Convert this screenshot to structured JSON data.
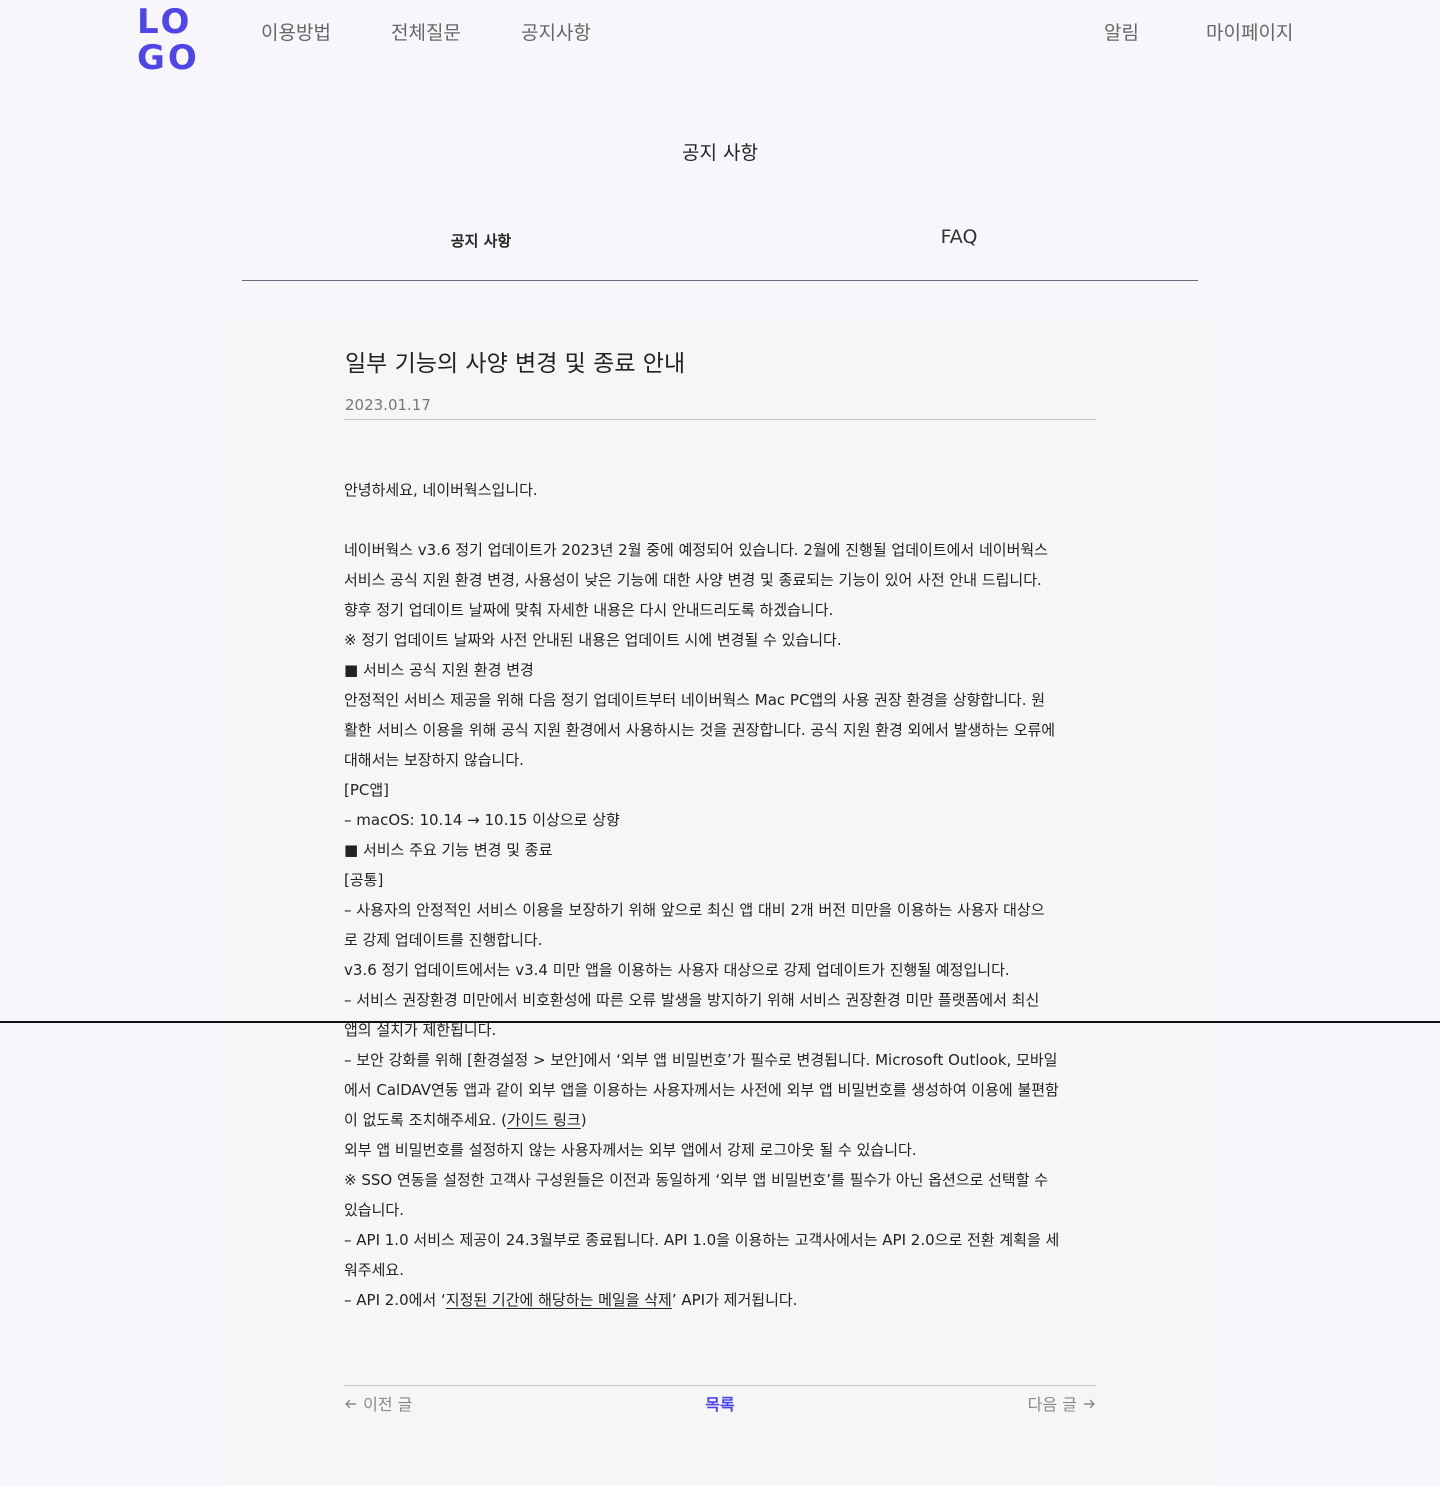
{
  "header": {
    "logo_line1": "LO",
    "logo_line2": "GO",
    "nav_left": [
      "이용방법",
      "전체질문",
      "공지사항"
    ],
    "nav_right": [
      "알림",
      "마이페이지"
    ],
    "accent_color": "#4f46e5"
  },
  "page": {
    "title": "공지 사항",
    "tabs": [
      "공지 사항",
      "FAQ"
    ]
  },
  "post": {
    "title": "일부 기능의 사양 변경 및 종료 안내",
    "date": "2023.01.17",
    "lines": [
      "안녕하세요, 네이버웍스입니다.",
      "",
      "네이버웍스 v3.6 정기 업데이트가 2023년 2월 중에 예정되어 있습니다. 2월에 진행될 업데이트에서 네이버웍스",
      "서비스 공식 지원 환경 변경, 사용성이 낮은 기능에 대한 사양 변경 및 종료되는 기능이 있어 사전 안내 드립니다.",
      "향후 정기 업데이트 날짜에 맞춰 자세한 내용은 다시 안내드리도록 하겠습니다.",
      "※ 정기 업데이트 날짜와 사전 안내된 내용은 업데이트 시에 변경될 수 있습니다.",
      "■ 서비스 공식 지원 환경 변경",
      "안정적인 서비스 제공을 위해 다음 정기 업데이트부터 네이버웍스 Mac PC앱의 사용 권장 환경을 상향합니다. 원",
      "활한 서비스 이용을 위해 공식 지원 환경에서 사용하시는 것을 권장합니다. 공식 지원 환경 외에서 발생하는 오류에",
      "대해서는 보장하지 않습니다.",
      "[PC앱]",
      "– macOS: 10.14 → 10.15 이상으로 상향",
      "■ 서비스 주요 기능 변경 및 종료",
      "[공통]",
      "– 사용자의 안정적인 서비스 이용을 보장하기 위해 앞으로 최신 앱 대비 2개 버전 미만을 이용하는 사용자 대상으",
      "로 강제 업데이트를 진행합니다.",
      "v3.6 정기 업데이트에서는 v3.4 미만 앱을 이용하는 사용자 대상으로 강제 업데이트가 진행될 예정입니다.",
      "– 서비스 권장환경 미만에서 비호환성에 따른 오류 발생을 방지하기 위해 서비스 권장환경 미만 플랫폼에서 최신",
      "앱의 설치가 제한됩니다.",
      "– 보안 강화를 위해 [환경설정 > 보안]에서 ‘외부 앱 비밀번호’가 필수로 변경됩니다. Microsoft Outlook, 모바일",
      "에서 CalDAV연동 앱과 같이 외부 앱을 이용하는 사용자께서는 사전에 외부 앱 비밀번호를 생성하여 이용에 불편함"
    ],
    "line_guide_before": "이 없도록 조치해주세요. (",
    "line_guide_link": "가이드 링크",
    "line_guide_after": ")",
    "lines2": [
      "외부 앱 비밀번호를 설정하지 않는 사용자께서는 외부 앱에서 강제 로그아웃 될 수 있습니다.",
      "※ SSO 연동을 설정한 고객사 구성원들은 이전과 동일하게 ‘외부 앱 비밀번호’를 필수가 아닌 옵션으로 선택할 수",
      "있습니다.",
      "– API 1.0 서비스 제공이 24.3월부로 종료됩니다. API 1.0을 이용하는 고객사에서는 API 2.0으로 전환 계획을 세",
      "워주세요."
    ],
    "line_api_before": "– API 2.0에서 ‘",
    "line_api_link": "지정된 기간에 해당하는 메일을 삭제",
    "line_api_after": "’ API가 제거됩니다."
  },
  "pager": {
    "prev": "이전 글",
    "list": "목록",
    "next": "다음 글"
  }
}
